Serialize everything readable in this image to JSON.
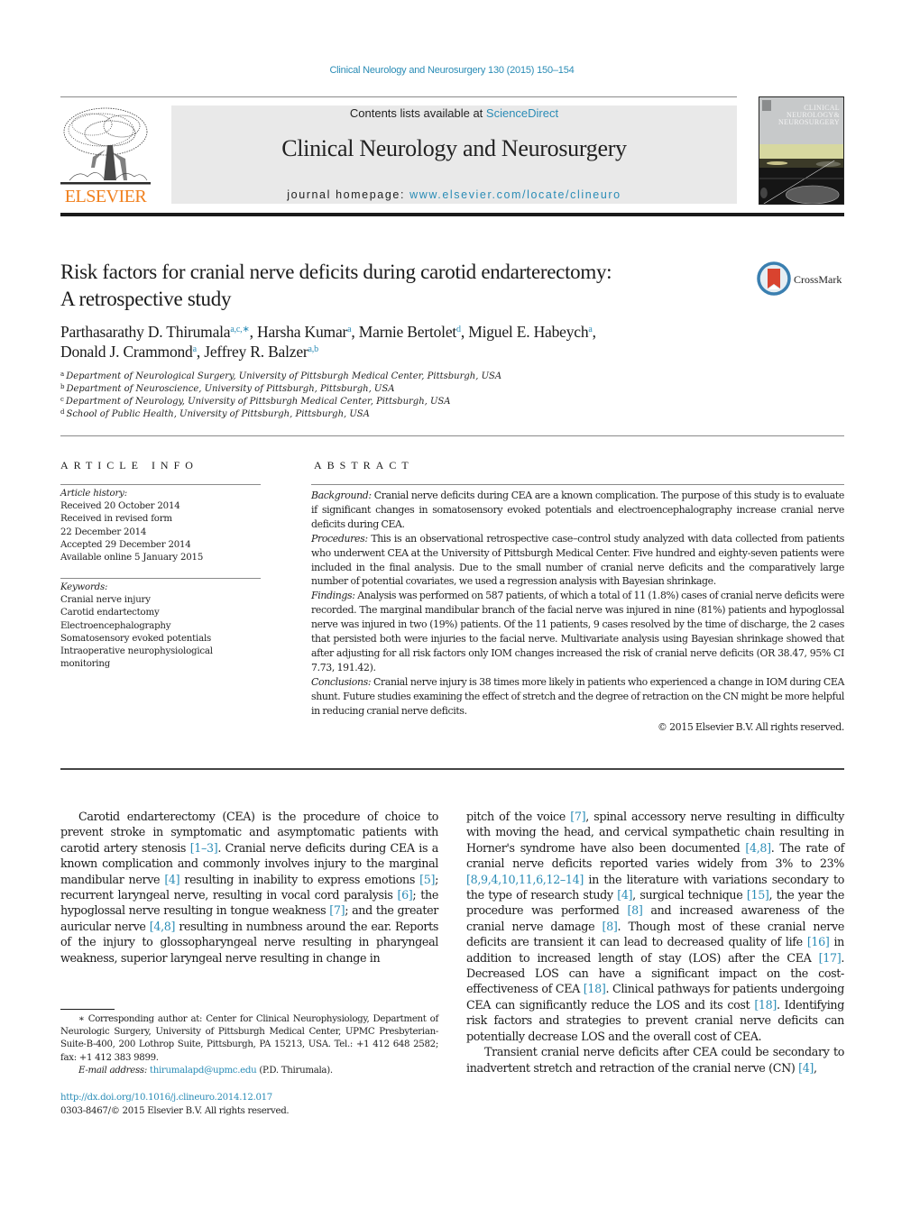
{
  "running_header": "Clinical Neurology and Neurosurgery 130 (2015) 150–154",
  "publisher": {
    "wordmark": "ELSEVIER",
    "color": "#f07f1c"
  },
  "banner": {
    "contents_prefix": "Contents lists available at ",
    "contents_link": "ScienceDirect",
    "journal_title": "Clinical Neurology and Neurosurgery",
    "homepage_prefix": "journal homepage: ",
    "homepage_link": "www.elsevier.com/locate/clineuro",
    "background": "#e9e9e9"
  },
  "cover": {
    "title_lines": [
      "CLINICAL",
      "NEUROLOGY&",
      "NEUROSURGERY"
    ]
  },
  "crossmark": {
    "label": "CrossMark"
  },
  "article": {
    "title_line1": "Risk factors for cranial nerve deficits during carotid endarterectomy:",
    "title_line2": "A retrospective study",
    "authors": [
      {
        "name": "Parthasarathy D. Thirumala",
        "affil": "a,c,∗",
        "sep": ", "
      },
      {
        "name": "Harsha Kumar",
        "affil": "a",
        "sep": ", "
      },
      {
        "name": "Marnie Bertolet",
        "affil": "d",
        "sep": ", "
      },
      {
        "name": "Miguel E. Habeych",
        "affil": "a",
        "sep": ","
      },
      {
        "name": "Donald J. Crammond",
        "affil": "a",
        "sep": ", "
      },
      {
        "name": "Jeffrey R. Balzer",
        "affil": "a,b",
        "sep": ""
      }
    ],
    "affiliations": [
      {
        "key": "a",
        "text": "Department of Neurological Surgery, University of Pittsburgh Medical Center, Pittsburgh, USA"
      },
      {
        "key": "b",
        "text": "Department of Neuroscience, University of Pittsburgh, Pittsburgh, USA"
      },
      {
        "key": "c",
        "text": "Department of Neurology, University of Pittsburgh Medical Center, Pittsburgh, USA"
      },
      {
        "key": "d",
        "text": "School of Public Health, University of Pittsburgh, Pittsburgh, USA"
      }
    ]
  },
  "article_info": {
    "heading": "ARTICLE INFO",
    "history_label": "Article history:",
    "history": [
      "Received 20 October 2014",
      "Received in revised form",
      "22 December 2014",
      "Accepted 29 December 2014",
      "Available online 5 January 2015"
    ],
    "keywords_label": "Keywords:",
    "keywords": [
      "Cranial nerve injury",
      "Carotid endartectomy",
      "Electroencephalography",
      "Somatosensory evoked potentials",
      "Intraoperative neurophysiological",
      "monitoring"
    ]
  },
  "abstract": {
    "heading": "ABSTRACT",
    "sections": [
      {
        "label": "Background:",
        "text": " Cranial nerve deficits during CEA are a known complication. The purpose of this study is to evaluate if significant changes in somatosensory evoked potentials and electroencephalography increase cranial nerve deficits during CEA."
      },
      {
        "label": "Procedures:",
        "text": " This is an observational retrospective case–control study analyzed with data collected from patients who underwent CEA at the University of Pittsburgh Medical Center. Five hundred and eighty-seven patients were included in the final analysis. Due to the small number of cranial nerve deficits and the comparatively large number of potential covariates, we used a regression analysis with Bayesian shrinkage."
      },
      {
        "label": "Findings:",
        "text": " Analysis was performed on 587 patients, of which a total of 11 (1.8%) cases of cranial nerve deficits were recorded. The marginal mandibular branch of the facial nerve was injured in nine (81%) patients and hypoglossal nerve was injured in two (19%) patients. Of the 11 patients, 9 cases resolved by the time of discharge, the 2 cases that persisted both were injuries to the facial nerve. Multivariate analysis using Bayesian shrinkage showed that after adjusting for all risk factors only IOM changes increased the risk of cranial nerve deficits (OR 38.47, 95% CI 7.73, 191.42)."
      },
      {
        "label": "Conclusions:",
        "text": " Cranial nerve injury is 38 times more likely in patients who experienced a change in IOM during CEA shunt. Future studies examining the effect of stretch and the degree of retraction on the CN might be more helpful in reducing cranial nerve deficits."
      }
    ],
    "copyright": "© 2015 Elsevier B.V. All rights reserved."
  },
  "body": {
    "left_column": [
      {
        "type": "text",
        "v": "Carotid endarterectomy (CEA) is the procedure of choice to prevent stroke in symptomatic and asymptomatic patients with carotid artery stenosis "
      },
      {
        "type": "ref",
        "v": "[1–3]"
      },
      {
        "type": "text",
        "v": ". Cranial nerve deficits during CEA is a known complication and commonly involves injury to the marginal mandibular nerve "
      },
      {
        "type": "ref",
        "v": "[4]"
      },
      {
        "type": "text",
        "v": " resulting in inability to express emotions "
      },
      {
        "type": "ref",
        "v": "[5]"
      },
      {
        "type": "text",
        "v": "; recurrent laryngeal nerve, resulting in vocal cord paralysis "
      },
      {
        "type": "ref",
        "v": "[6]"
      },
      {
        "type": "text",
        "v": "; the hypoglossal nerve resulting in tongue weakness "
      },
      {
        "type": "ref",
        "v": "[7]"
      },
      {
        "type": "text",
        "v": "; and the greater auricular nerve "
      },
      {
        "type": "ref",
        "v": "[4,8]"
      },
      {
        "type": "text",
        "v": " resulting in numbness around the ear. Reports of the injury to glossopharyngeal nerve resulting in pharyngeal weakness, superior laryngeal nerve resulting in change in"
      }
    ],
    "right_column_p1": [
      {
        "type": "text",
        "v": "pitch of the voice "
      },
      {
        "type": "ref",
        "v": "[7]"
      },
      {
        "type": "text",
        "v": ", spinal accessory nerve resulting in difficulty with moving the head, and cervical sympathetic chain resulting in Horner's syndrome have also been documented "
      },
      {
        "type": "ref",
        "v": "[4,8]"
      },
      {
        "type": "text",
        "v": ". The rate of cranial nerve deficits reported varies widely from 3% to 23% "
      },
      {
        "type": "ref",
        "v": "[8,9,4,10,11,6,12–14]"
      },
      {
        "type": "text",
        "v": " in the literature with variations secondary to the type of research study "
      },
      {
        "type": "ref",
        "v": "[4]"
      },
      {
        "type": "text",
        "v": ", surgical technique "
      },
      {
        "type": "ref",
        "v": "[15]"
      },
      {
        "type": "text",
        "v": ", the year the procedure was performed "
      },
      {
        "type": "ref",
        "v": "[8]"
      },
      {
        "type": "text",
        "v": " and increased awareness of the cranial nerve damage "
      },
      {
        "type": "ref",
        "v": "[8]"
      },
      {
        "type": "text",
        "v": ". Though most of these cranial nerve deficits are transient it can lead to decreased quality of life "
      },
      {
        "type": "ref",
        "v": "[16]"
      },
      {
        "type": "text",
        "v": " in addition to increased length of stay (LOS) after the CEA "
      },
      {
        "type": "ref",
        "v": "[17]"
      },
      {
        "type": "text",
        "v": ". Decreased LOS can have a significant impact on the cost-effectiveness of CEA "
      },
      {
        "type": "ref",
        "v": "[18]"
      },
      {
        "type": "text",
        "v": ". Clinical pathways for patients undergoing CEA can significantly reduce the LOS and its cost "
      },
      {
        "type": "ref",
        "v": "[18]"
      },
      {
        "type": "text",
        "v": ". Identifying risk factors and strategies to prevent cranial nerve deficits can potentially decrease LOS and the overall cost of CEA."
      }
    ],
    "right_column_p2": [
      {
        "type": "text",
        "v": "Transient cranial nerve deficits after CEA could be secondary to inadvertent stretch and retraction of the cranial nerve (CN) "
      },
      {
        "type": "ref",
        "v": "[4]"
      },
      {
        "type": "text",
        "v": ","
      }
    ]
  },
  "footnotes": {
    "corresponding": "∗ Corresponding author at: Center for Clinical Neurophysiology, Department of Neurologic Surgery, University of Pittsburgh Medical Center, UPMC Presbyterian-Suite-B-400, 200 Lothrop Suite, Pittsburgh, PA 15213, USA. Tel.: +1 412 648 2582; fax: +1 412 383 9899.",
    "email_label": "E-mail address:",
    "email": "thirumalapd@upmc.edu",
    "email_suffix": " (P.D. Thirumala)."
  },
  "doi": {
    "link": "http://dx.doi.org/10.1016/j.clineuro.2014.12.017",
    "issn_line": "0303-8467/© 2015 Elsevier B.V. All rights reserved."
  },
  "colors": {
    "link": "#2a8cb6",
    "crossmark_red": "#d9432f",
    "crossmark_blue": "#3a7fb0"
  }
}
